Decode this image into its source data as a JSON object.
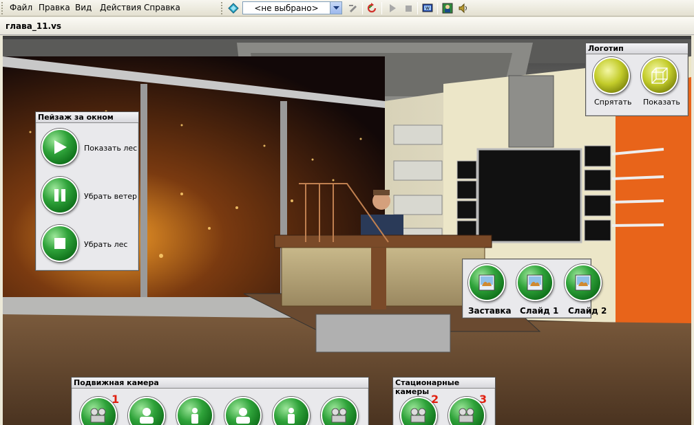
{
  "menu": {
    "items": [
      "Файл",
      "Правка",
      "Вид",
      "Действия",
      "Справка"
    ]
  },
  "toolbar": {
    "scene_select_value": "<не выбрано>"
  },
  "document": {
    "tab_title": "глава_11.vs"
  },
  "panels": {
    "landscape": {
      "title": "Пейзаж за окном",
      "buttons": [
        "Показать лес",
        "Убрать ветер",
        "Убрать лес"
      ]
    },
    "logo": {
      "title": "Логотип",
      "buttons": [
        "Спрятать",
        "Показать"
      ]
    },
    "slides": {
      "buttons": [
        "Заставка",
        "Слайд 1",
        "Слайд 2"
      ]
    },
    "moving_camera": {
      "title": "Подвижная камера",
      "badge": "1"
    },
    "static_cameras": {
      "title": "Стационарные камеры",
      "badges": [
        "2",
        "3"
      ]
    }
  },
  "colors": {
    "button_green": "#1f8f2c",
    "logo_yellow": "#c3cc2a",
    "badge_red": "#e02010",
    "wall_orange": "#e8641a"
  }
}
